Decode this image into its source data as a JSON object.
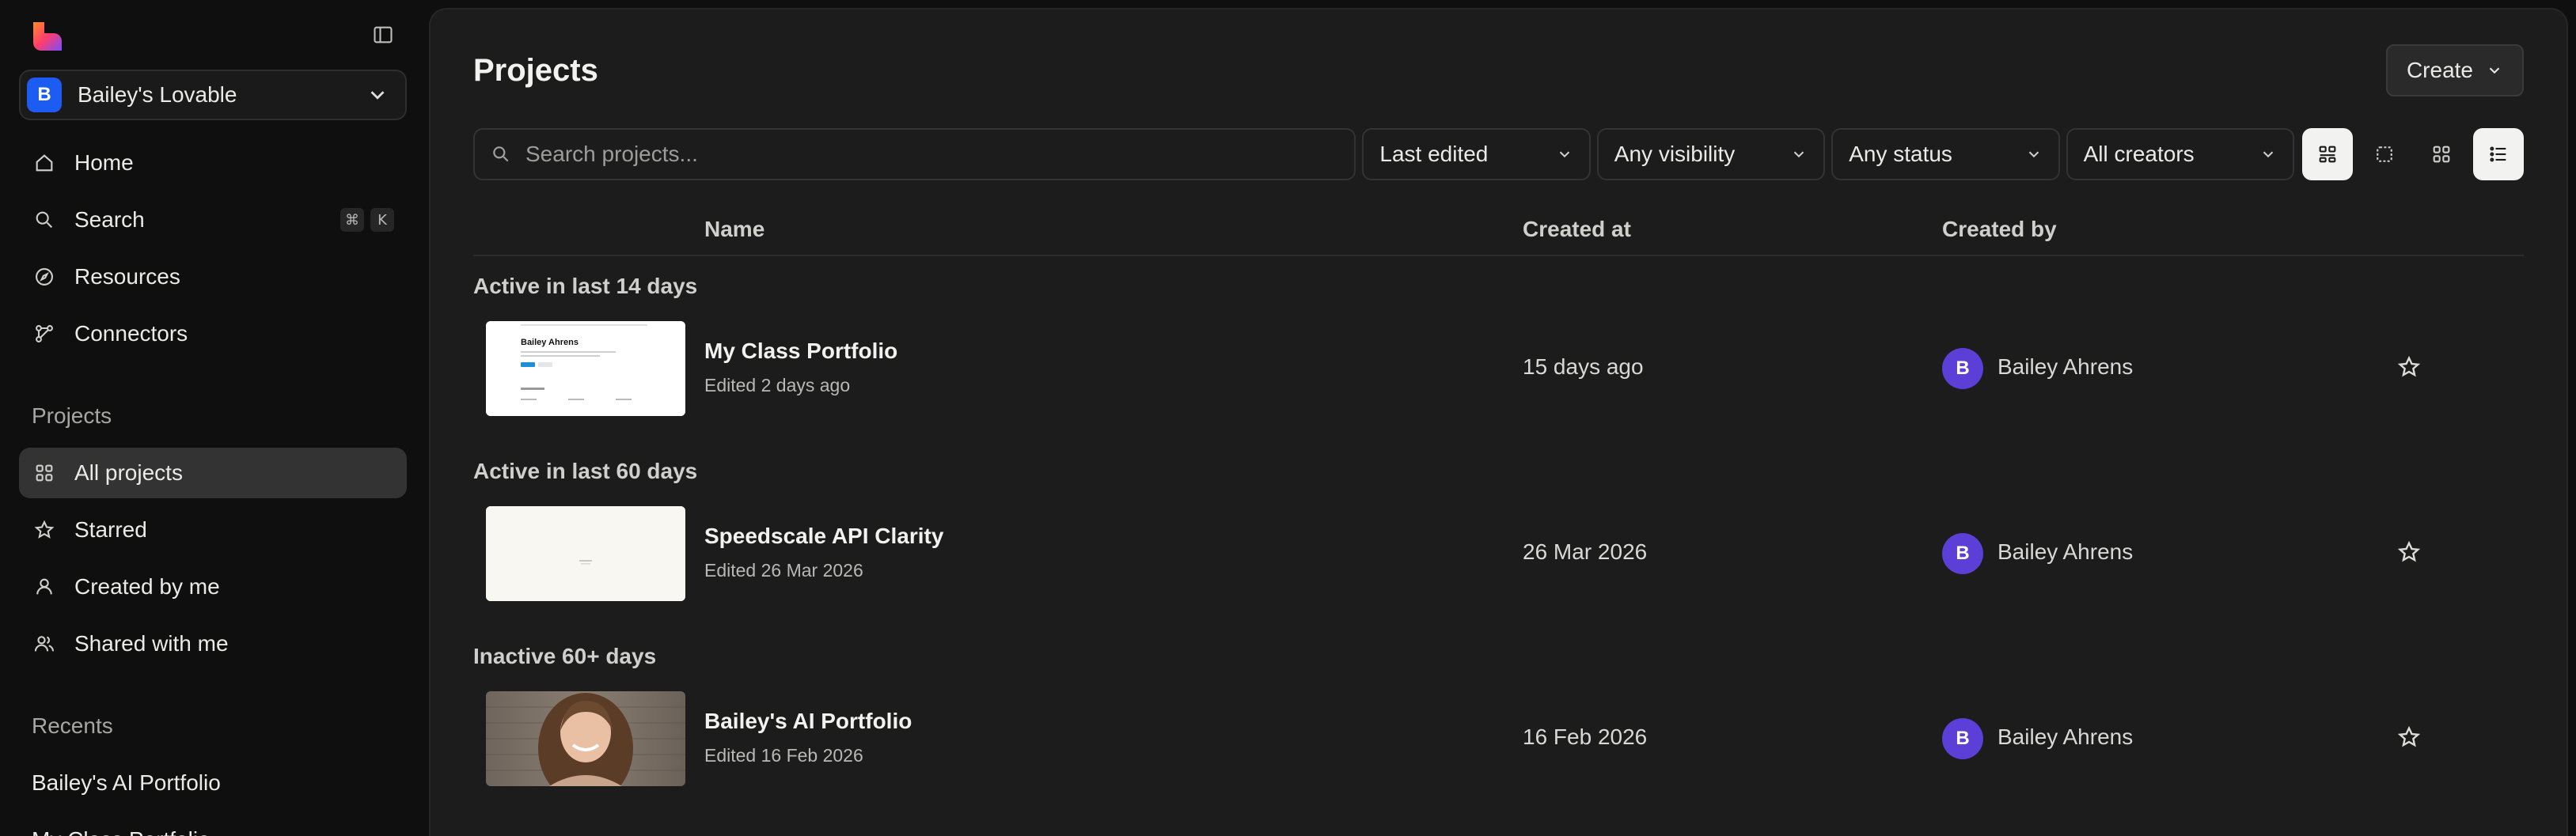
{
  "sidebar": {
    "workspace": {
      "initial": "B",
      "name": "Bailey's Lovable"
    },
    "nav": [
      {
        "label": "Home",
        "icon": "home-icon"
      },
      {
        "label": "Search",
        "icon": "search-icon",
        "shortcut": [
          "⌘",
          "K"
        ]
      },
      {
        "label": "Resources",
        "icon": "compass-icon"
      },
      {
        "label": "Connectors",
        "icon": "connectors-icon"
      }
    ],
    "projects_label": "Projects",
    "projects": [
      {
        "label": "All projects",
        "icon": "grid-icon",
        "active": true
      },
      {
        "label": "Starred",
        "icon": "star-icon"
      },
      {
        "label": "Created by me",
        "icon": "user-icon"
      },
      {
        "label": "Shared with me",
        "icon": "users-icon"
      }
    ],
    "recents_label": "Recents",
    "recents": [
      "Bailey's AI Portfolio",
      "My Class Portfolio"
    ]
  },
  "header": {
    "title": "Projects",
    "create_label": "Create"
  },
  "toolbar": {
    "search_placeholder": "Search projects...",
    "sort": "Last edited",
    "visibility": "Any visibility",
    "status": "Any status",
    "creators": "All creators"
  },
  "table": {
    "columns": {
      "name": "Name",
      "created_at": "Created at",
      "created_by": "Created by"
    },
    "groups": [
      {
        "label": "Active in last 14 days",
        "rows": [
          {
            "title": "My Class Portfolio",
            "edited": "Edited 2 days ago",
            "created": "15 days ago",
            "creator_initial": "B",
            "creator": "Bailey Ahrens",
            "thumb_heading": "Bailey Ahrens"
          }
        ]
      },
      {
        "label": "Active in last 60 days",
        "rows": [
          {
            "title": "Speedscale API Clarity",
            "edited": "Edited 26 Mar 2026",
            "created": "26 Mar 2026",
            "creator_initial": "B",
            "creator": "Bailey Ahrens"
          }
        ]
      },
      {
        "label": "Inactive 60+ days",
        "rows": [
          {
            "title": "Bailey's AI Portfolio",
            "edited": "Edited 16 Feb 2026",
            "created": "16 Feb 2026",
            "creator_initial": "B",
            "creator": "Bailey Ahrens"
          }
        ]
      }
    ]
  },
  "colors": {
    "accent_blue": "#1d5cf2",
    "avatar_purple": "#5b3fd6",
    "active_nav": "#333333"
  }
}
